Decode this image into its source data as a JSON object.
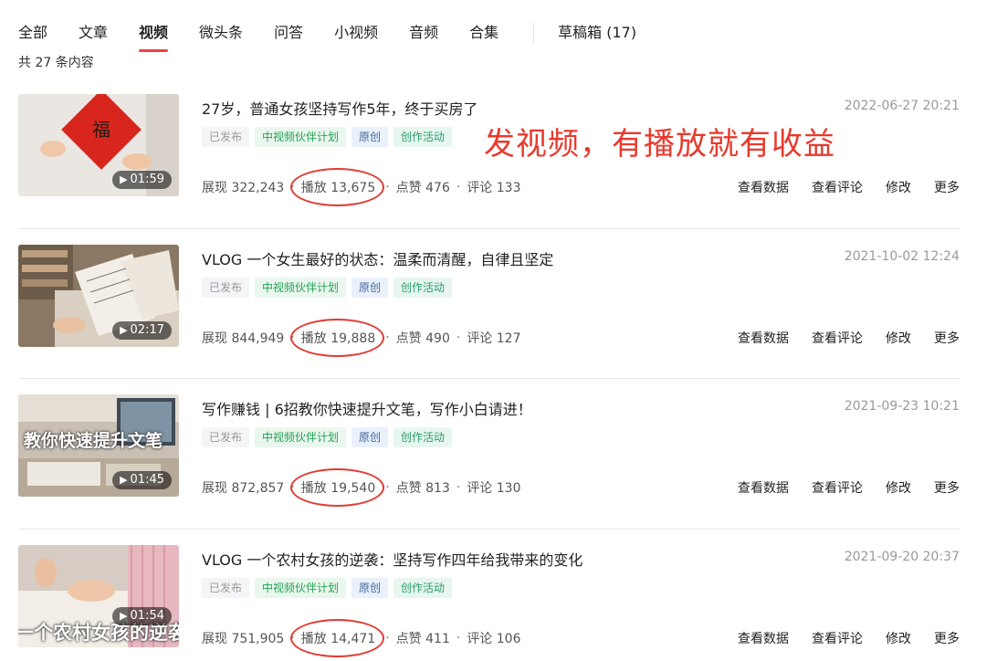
{
  "tabs": [
    {
      "label": "全部"
    },
    {
      "label": "文章"
    },
    {
      "label": "视频"
    },
    {
      "label": "微头条"
    },
    {
      "label": "问答"
    },
    {
      "label": "小视频"
    },
    {
      "label": "音频"
    },
    {
      "label": "合集"
    }
  ],
  "active_tab": "视频",
  "drafts_label": "草稿箱 (17)",
  "total_label": "共 27 条内容",
  "promo_text": "发视频，有播放就有收益",
  "colors": {
    "accent": "#f04142",
    "annotation": "#e23a32"
  },
  "actions": {
    "data": "查看数据",
    "comments": "查看评论",
    "edit": "修改",
    "more": "更多"
  },
  "items": [
    {
      "title": "27岁，普通女孩坚持写作5年，终于买房了",
      "time": "2022-06-27 20:21",
      "duration": "01:59",
      "overlay": "",
      "tags": [
        "已发布",
        "中视频伙伴计划",
        "原创",
        "创作活动"
      ],
      "impressions": "展现 322,243",
      "plays": "播放 13,675",
      "likes": "点赞 476",
      "comments": "评论 133"
    },
    {
      "title": "VLOG 一个女生最好的状态：温柔而清醒，自律且坚定",
      "time": "2021-10-02 12:24",
      "duration": "02:17",
      "overlay": "",
      "tags": [
        "已发布",
        "中视频伙伴计划",
        "原创",
        "创作活动"
      ],
      "impressions": "展现 844,949",
      "plays": "播放 19,888",
      "likes": "点赞 490",
      "comments": "评论 127"
    },
    {
      "title": "写作赚钱 | 6招教你快速提升文笔，写作小白请进！",
      "time": "2021-09-23 10:21",
      "duration": "01:45",
      "overlay": "教你快速提升文笔",
      "tags": [
        "已发布",
        "中视频伙伴计划",
        "原创",
        "创作活动"
      ],
      "impressions": "展现 872,857",
      "plays": "播放 19,540",
      "likes": "点赞 813",
      "comments": "评论 130"
    },
    {
      "title": "VLOG 一个农村女孩的逆袭：坚持写作四年给我带来的变化",
      "time": "2021-09-20 20:37",
      "duration": "01:54",
      "overlay": "一个农村女孩的逆袭",
      "tags": [
        "已发布",
        "中视频伙伴计划",
        "原创",
        "创作活动"
      ],
      "impressions": "展现 751,905",
      "plays": "播放 14,471",
      "likes": "点赞 411",
      "comments": "评论 106"
    }
  ]
}
